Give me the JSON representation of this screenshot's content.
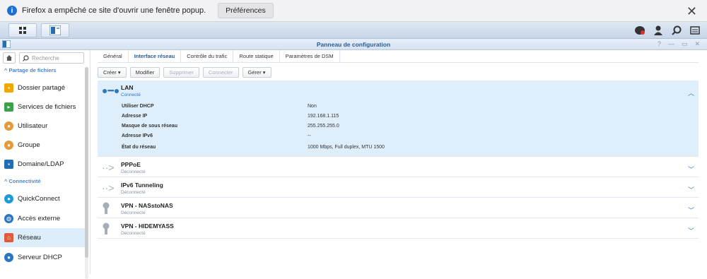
{
  "popup": {
    "message": "Firefox a empêché ce site d'ouvrir une fenêtre popup.",
    "preferences_label": "Préférences",
    "close_label": "✕"
  },
  "window": {
    "title": "Panneau de configuration",
    "controls": [
      "?",
      "—",
      "▭",
      "✕"
    ]
  },
  "sidebar": {
    "search_placeholder": "Recherche",
    "sections": [
      {
        "title": "Partage de fichiers",
        "items": [
          {
            "label": "Dossier partagé",
            "icon": "folder-icon",
            "color": "#f0a800"
          },
          {
            "label": "Services de fichiers",
            "icon": "file-services-icon",
            "color": "#3aa34a"
          },
          {
            "label": "Utilisateur",
            "icon": "user-icon",
            "color": "#e29a3c"
          },
          {
            "label": "Groupe",
            "icon": "group-icon",
            "color": "#e29a3c"
          },
          {
            "label": "Domaine/LDAP",
            "icon": "domain-icon",
            "color": "#1f6cb7"
          }
        ]
      },
      {
        "title": "Connectivité",
        "items": [
          {
            "label": "QuickConnect",
            "icon": "quickconnect-icon",
            "color": "#1e9bd7"
          },
          {
            "label": "Accès externe",
            "icon": "globe-icon",
            "color": "#2b76c2"
          },
          {
            "label": "Réseau",
            "icon": "network-icon",
            "color": "#e05b3a"
          },
          {
            "label": "Serveur DHCP",
            "icon": "dhcp-icon",
            "color": "#2b76c2"
          }
        ]
      }
    ]
  },
  "tabs": [
    "Général",
    "Interface réseau",
    "Contrôle du trafic",
    "Route statique",
    "Paramètres de DSM"
  ],
  "toolbar": {
    "create": "Créer ▾",
    "modify": "Modifier",
    "delete": "Supprimer",
    "connect": "Connecter",
    "manage": "Gérer ▾"
  },
  "interfaces": [
    {
      "name": "LAN",
      "status": "Connecté",
      "connected": true,
      "details": [
        {
          "label": "Utiliser DHCP",
          "value": "Non"
        },
        {
          "label": "Adresse IP",
          "value": "192.168.1.115"
        },
        {
          "label": "Masque de sous réseau",
          "value": "255.255.255.0"
        },
        {
          "label": "Adresse IPv6",
          "value": "--"
        },
        {
          "label": "État du réseau",
          "value": "1000 Mbps, Full duplex, MTU 1500"
        }
      ]
    },
    {
      "name": "PPPoE",
      "status": "Déconnecté",
      "connected": false
    },
    {
      "name": "IPv6 Tunneling",
      "status": "Déconnecté",
      "connected": false
    },
    {
      "name": "VPN - NASstoNAS",
      "status": "Déconnecté",
      "connected": false
    },
    {
      "name": "VPN - HIDEMYASS",
      "status": "Déconnecté",
      "connected": false
    }
  ],
  "colors": {
    "accent": "#2f79c0",
    "selected": "#deeefb"
  }
}
